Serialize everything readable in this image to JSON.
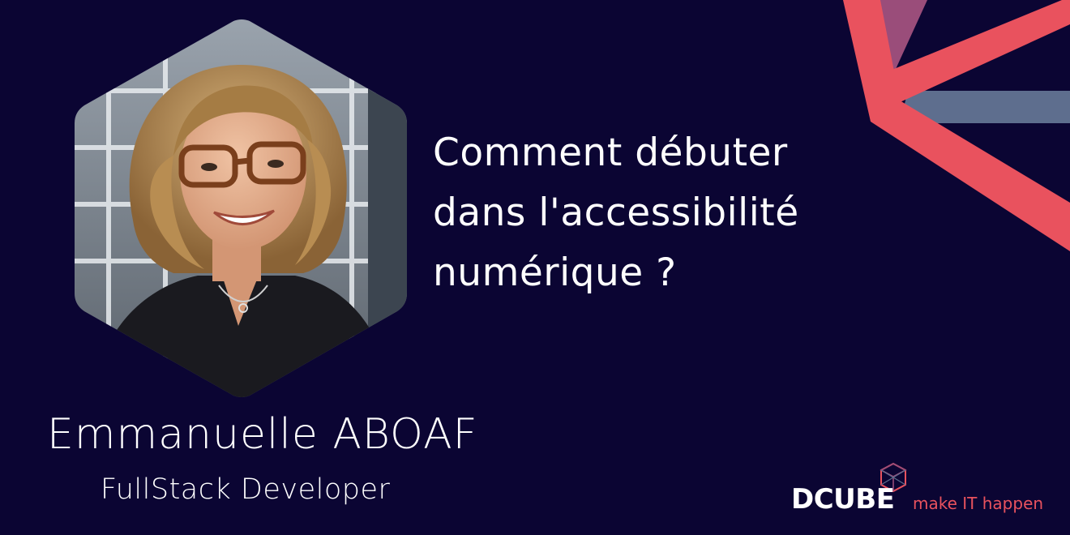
{
  "headline": {
    "line1": "Comment débuter",
    "line2": "dans l'accessibilité",
    "line3": "numérique ?"
  },
  "speaker": {
    "name": "Emmanuelle ABOAF",
    "role": "FullStack Developer"
  },
  "brand": {
    "name": "Dcube",
    "tagline": "make IT happen"
  },
  "colors": {
    "background": "#0b0533",
    "accent_red": "#e9525e",
    "accent_slate": "#5e6e8e",
    "accent_mauve": "#9a4d7a",
    "text": "#ffffff"
  }
}
